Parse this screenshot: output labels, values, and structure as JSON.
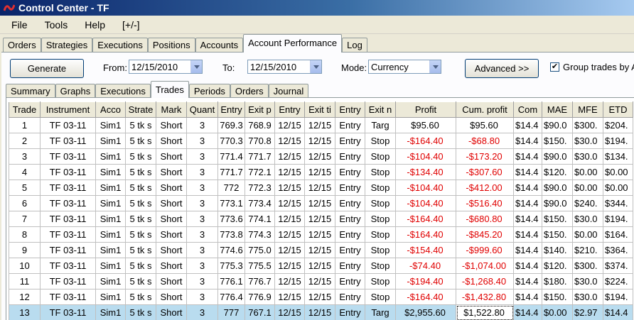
{
  "window": {
    "title": "Control Center - TF"
  },
  "menu": [
    "File",
    "Tools",
    "Help",
    "[+/-]"
  ],
  "main_tabs": [
    "Orders",
    "Strategies",
    "Executions",
    "Positions",
    "Accounts",
    "Account Performance",
    "Log"
  ],
  "toolbar": {
    "generate_label": "Generate",
    "from_label": "From:",
    "from_value": "12/15/2010",
    "to_label": "To:",
    "to_value": "12/15/2010",
    "mode_label": "Mode:",
    "mode_value": "Currency",
    "advanced_label": "Advanced >>",
    "group_label": "Group trades by A",
    "group_checked": "✔"
  },
  "sub_tabs": [
    "Summary",
    "Graphs",
    "Executions",
    "Trades",
    "Periods",
    "Orders",
    "Journal"
  ],
  "table": {
    "headers": [
      "Trade",
      "Instrument",
      "Acco",
      "Strate",
      "Mark",
      "Quant",
      "Entry",
      "Exit p",
      "Entry",
      "Exit ti",
      "Entry",
      "Exit n",
      "Profit",
      "Cum. profit",
      "Com",
      "MAE",
      "MFE",
      "ETD"
    ],
    "rows": [
      [
        "1",
        "TF 03-11",
        "Sim1",
        "5 tk s",
        "Short",
        "3",
        "769.3",
        "768.9",
        "12/15",
        "12/15",
        "Entry",
        "Targ",
        "$95.60",
        "$95.60",
        "$14.4",
        "$90.0",
        "$300.",
        "$204."
      ],
      [
        "2",
        "TF 03-11",
        "Sim1",
        "5 tk s",
        "Short",
        "3",
        "770.3",
        "770.8",
        "12/15",
        "12/15",
        "Entry",
        "Stop",
        "-$164.40",
        "-$68.80",
        "$14.4",
        "$150.",
        "$30.0",
        "$194."
      ],
      [
        "3",
        "TF 03-11",
        "Sim1",
        "5 tk s",
        "Short",
        "3",
        "771.4",
        "771.7",
        "12/15",
        "12/15",
        "Entry",
        "Stop",
        "-$104.40",
        "-$173.20",
        "$14.4",
        "$90.0",
        "$30.0",
        "$134."
      ],
      [
        "4",
        "TF 03-11",
        "Sim1",
        "5 tk s",
        "Short",
        "3",
        "771.7",
        "772.1",
        "12/15",
        "12/15",
        "Entry",
        "Stop",
        "-$134.40",
        "-$307.60",
        "$14.4",
        "$120.",
        "$0.00",
        "$0.00"
      ],
      [
        "5",
        "TF 03-11",
        "Sim1",
        "5 tk s",
        "Short",
        "3",
        "772",
        "772.3",
        "12/15",
        "12/15",
        "Entry",
        "Stop",
        "-$104.40",
        "-$412.00",
        "$14.4",
        "$90.0",
        "$0.00",
        "$0.00"
      ],
      [
        "6",
        "TF 03-11",
        "Sim1",
        "5 tk s",
        "Short",
        "3",
        "773.1",
        "773.4",
        "12/15",
        "12/15",
        "Entry",
        "Stop",
        "-$104.40",
        "-$516.40",
        "$14.4",
        "$90.0",
        "$240.",
        "$344."
      ],
      [
        "7",
        "TF 03-11",
        "Sim1",
        "5 tk s",
        "Short",
        "3",
        "773.6",
        "774.1",
        "12/15",
        "12/15",
        "Entry",
        "Stop",
        "-$164.40",
        "-$680.80",
        "$14.4",
        "$150.",
        "$30.0",
        "$194."
      ],
      [
        "8",
        "TF 03-11",
        "Sim1",
        "5 tk s",
        "Short",
        "3",
        "773.8",
        "774.3",
        "12/15",
        "12/15",
        "Entry",
        "Stop",
        "-$164.40",
        "-$845.20",
        "$14.4",
        "$150.",
        "$0.00",
        "$164."
      ],
      [
        "9",
        "TF 03-11",
        "Sim1",
        "5 tk s",
        "Short",
        "3",
        "774.6",
        "775.0",
        "12/15",
        "12/15",
        "Entry",
        "Stop",
        "-$154.40",
        "-$999.60",
        "$14.4",
        "$140.",
        "$210.",
        "$364."
      ],
      [
        "10",
        "TF 03-11",
        "Sim1",
        "5 tk s",
        "Short",
        "3",
        "775.3",
        "775.5",
        "12/15",
        "12/15",
        "Entry",
        "Stop",
        "-$74.40",
        "-$1,074.00",
        "$14.4",
        "$120.",
        "$300.",
        "$374."
      ],
      [
        "11",
        "TF 03-11",
        "Sim1",
        "5 tk s",
        "Short",
        "3",
        "776.1",
        "776.7",
        "12/15",
        "12/15",
        "Entry",
        "Stop",
        "-$194.40",
        "-$1,268.40",
        "$14.4",
        "$180.",
        "$30.0",
        "$224."
      ],
      [
        "12",
        "TF 03-11",
        "Sim1",
        "5 tk s",
        "Short",
        "3",
        "776.4",
        "776.9",
        "12/15",
        "12/15",
        "Entry",
        "Stop",
        "-$164.40",
        "-$1,432.80",
        "$14.4",
        "$150.",
        "$30.0",
        "$194."
      ],
      [
        "13",
        "TF 03-11",
        "Sim1",
        "5 tk s",
        "Short",
        "3",
        "777",
        "767.1",
        "12/15",
        "12/15",
        "Entry",
        "Targ",
        "$2,955.60",
        "$1,522.80",
        "$14.4",
        "$0.00",
        "$2.97",
        "$14.4"
      ]
    ]
  },
  "colors": {
    "negative": "#e00000",
    "selected_row": "#b9dcef"
  }
}
